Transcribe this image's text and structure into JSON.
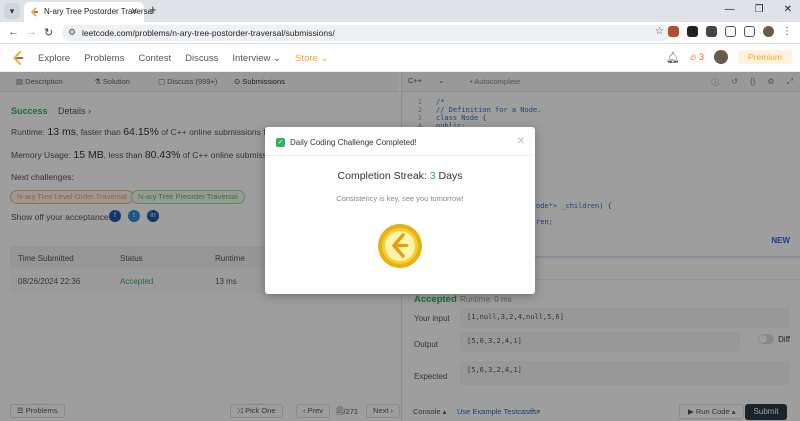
{
  "browser": {
    "tab_title": "N-ary Tree Postorder Traversal",
    "url": "leetcode.com/problems/n-ary-tree-postorder-traversal/submissions/",
    "new_tab": "+"
  },
  "nav": {
    "links": [
      "Explore",
      "Problems",
      "Contest",
      "Discuss",
      "Interview",
      "Store"
    ],
    "streak_count": "3",
    "premium": "Premium"
  },
  "left_tabs": [
    "Description",
    "Solution",
    "Discuss (999+)",
    "Submissions"
  ],
  "submission": {
    "status": "Success",
    "details": "Details ›",
    "runtime_prefix": "Runtime: ",
    "runtime_value": "13 ms",
    "runtime_mid": ", faster than ",
    "runtime_pct": "64.15%",
    "runtime_suffix": " of C++ online submissions for N-ary",
    "memory_prefix": "Memory Usage: ",
    "memory_value": "15 MB",
    "memory_mid": ", less than ",
    "memory_pct": "80.43%",
    "memory_suffix": " of C++ online submissions for N",
    "next_label": "Next challenges:",
    "next_challenges": [
      "N-ary Tree Level Order Traversal",
      "N-ary Tree Preorder Traversal"
    ],
    "share_label": "Show off your acceptance:"
  },
  "table": {
    "headers": [
      "Time Submitted",
      "Status",
      "Runtime"
    ],
    "rows": [
      {
        "time": "08/26/2024 22:36",
        "status": "Accepted",
        "runtime": "13 ms"
      }
    ]
  },
  "left_bottom": {
    "problems": "☰ Problems",
    "pick_one": "⤨ Pick One",
    "prev": "‹ Prev",
    "page": "🗐/271",
    "next": "Next ›"
  },
  "editor": {
    "language": "C++",
    "autocomplete": "• Autocomplete",
    "code_lines": [
      {
        "n": "1",
        "t": "/*"
      },
      {
        "n": "2",
        "t": "// Definition for a Node."
      },
      {
        "n": "3",
        "t": "class Node {"
      },
      {
        "n": "4",
        "t": "public:"
      }
    ],
    "fragment_1": "ode*> _children) {",
    "fragment_2": "ren;",
    "new_badge": "NEW"
  },
  "console": {
    "status": "Accepted",
    "runtime": "Runtime: 0 ms",
    "your_input_label": "Your input",
    "your_input": "[1,null,3,2,4,null,5,6]",
    "output_label": "Output",
    "output": "[5,6,3,2,4,1]",
    "expected_label": "Expected",
    "expected": "[5,6,3,2,4,1]",
    "diff_label": "Diff"
  },
  "right_bottom": {
    "console": "Console ▴",
    "example": "Use Example Testcases",
    "run": "▶ Run Code ▴",
    "submit": "Submit"
  },
  "modal": {
    "title": "Daily Coding Challenge Completed!",
    "streak_prefix": "Completion Streak: ",
    "streak_num": "3",
    "streak_suffix": " Days",
    "message": "Consistency is key, see you tomorrow!"
  },
  "colors": {
    "success_green": "#2db55d",
    "accent_orange": "#f5a623",
    "link_blue": "#1e6ad6",
    "coin_gold": "#f3c21c"
  }
}
